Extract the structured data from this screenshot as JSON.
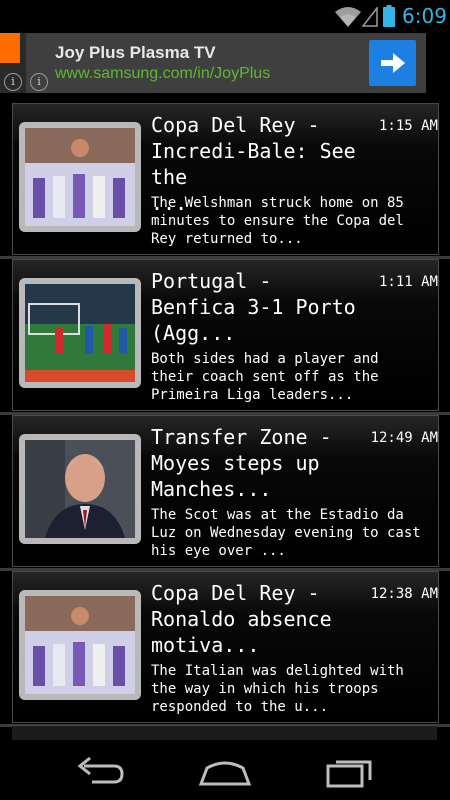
{
  "status_bar": {
    "time": "6:09"
  },
  "ad": {
    "title": "Joy Plus Plasma TV",
    "url": "www.samsung.com/in/JoyPlus"
  },
  "feed": {
    "items": [
      {
        "title": "Copa Del Rey -\nIncredi-Bale: See the\n...",
        "time": "1:15 AM",
        "description": "The Welshman struck home on 85\nminutes to ensure the Copa del\nRey returned to..."
      },
      {
        "title": "Portugal -\nBenfica 3-1 Porto\n(Agg...",
        "time": "1:11 AM",
        "description": "Both sides had a player and\ntheir coach sent off as the\nPrimeira Liga leaders..."
      },
      {
        "title": "Transfer Zone -\nMoyes steps up\nManches...",
        "time": "12:49 AM",
        "description": "The Scot was at the Estadio da\nLuz on Wednesday evening to cast\nhis eye over ..."
      },
      {
        "title": "Copa Del Rey -\nRonaldo absence\nmotiva...",
        "time": "12:38 AM",
        "description": "The Italian was delighted with\nthe way in which his troops\nresponded to the u..."
      }
    ]
  }
}
